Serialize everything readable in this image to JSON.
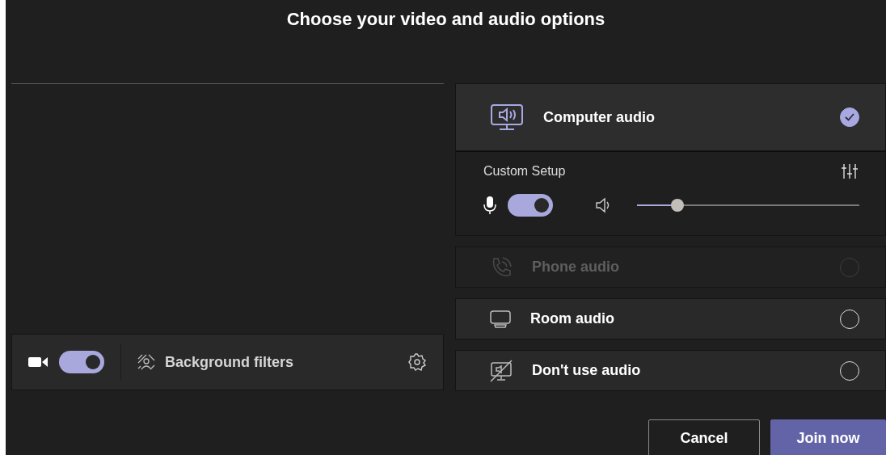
{
  "title": "Choose your video and audio options",
  "video": {
    "camera_on": true,
    "filters_label": "Background filters"
  },
  "audio_options": [
    {
      "kind": "computer",
      "label": "Computer audio",
      "selected": true,
      "disabled": false
    },
    {
      "kind": "phone",
      "label": "Phone audio",
      "selected": false,
      "disabled": true
    },
    {
      "kind": "room",
      "label": "Room audio",
      "selected": false,
      "disabled": false
    },
    {
      "kind": "none",
      "label": "Don't use audio",
      "selected": false,
      "disabled": false
    }
  ],
  "custom_setup": {
    "label": "Custom Setup",
    "mic_on": true,
    "speaker": {
      "level": 0.18
    }
  },
  "buttons": [
    {
      "kind": "secondary",
      "label": "Cancel"
    },
    {
      "kind": "primary",
      "label": "Join now"
    }
  ]
}
